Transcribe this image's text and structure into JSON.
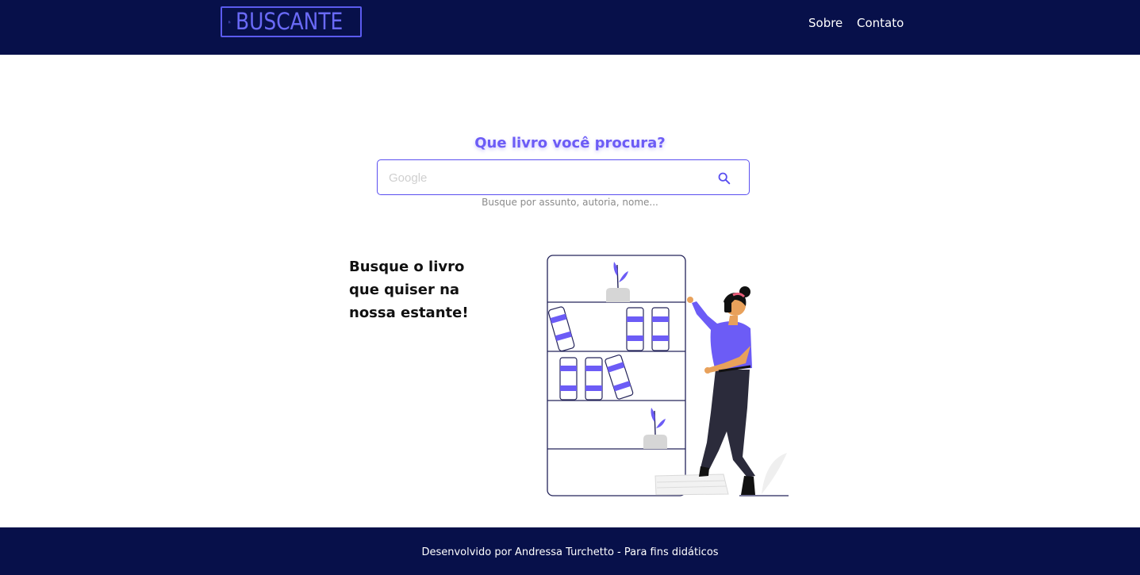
{
  "header": {
    "logo_text": "BUSCANTE",
    "nav": [
      {
        "label": "Sobre"
      },
      {
        "label": "Contato"
      }
    ]
  },
  "search": {
    "title": "Que livro você procura?",
    "placeholder": "Google",
    "hint": "Busque por assunto, autoria, nome..."
  },
  "promo": {
    "lines": [
      "Busque o livro",
      "que quiser na",
      "nossa estante!"
    ]
  },
  "footer": {
    "text": "Desenvolvido por Andressa Turchetto - Para fins didáticos"
  },
  "colors": {
    "navy": "#07104a",
    "accent": "#6c5cf6"
  }
}
